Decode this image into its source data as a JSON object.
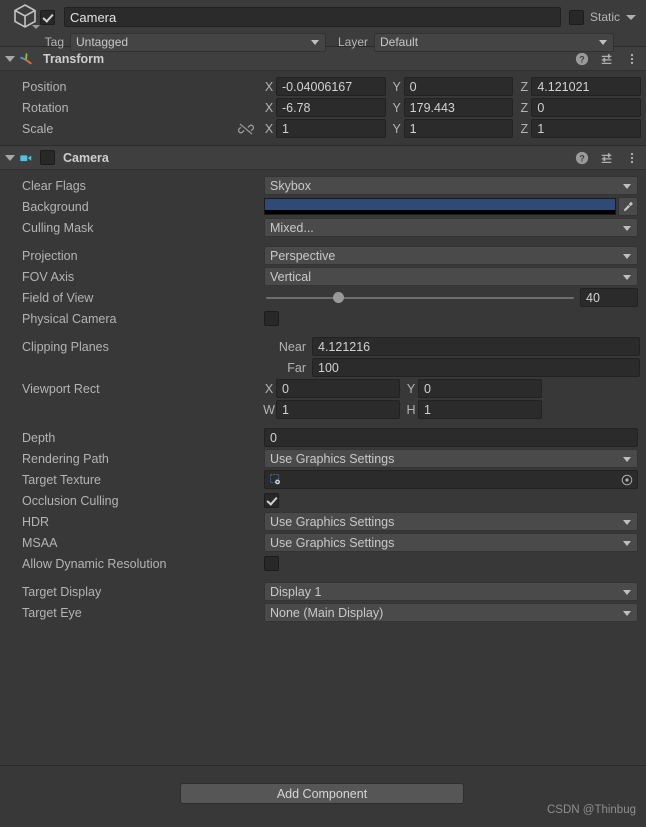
{
  "gameobject": {
    "icon": "cube-icon",
    "enabled_checkbox": true,
    "name_value": "Camera",
    "static_label": "Static",
    "static_checked": false,
    "tag_label": "Tag",
    "tag_value": "Untagged",
    "layer_label": "Layer",
    "layer_value": "Default"
  },
  "transform": {
    "title": "Transform",
    "icon": "transform-gizmo-icon",
    "expanded": true,
    "help_icon": "help-icon",
    "preset_icon": "preset-sliders-icon",
    "menu_icon": "three-dot-menu-icon",
    "rows": [
      {
        "label": "Position",
        "x": "-0.04006167",
        "y": "0",
        "z": "4.121021"
      },
      {
        "label": "Rotation",
        "x": "-6.78",
        "y": "179.443",
        "z": "0"
      },
      {
        "label": "Scale",
        "x": "1",
        "y": "1",
        "z": "1",
        "link_icon": "broken-link-icon"
      }
    ],
    "axis_labels": {
      "x": "X",
      "y": "Y",
      "z": "Z"
    }
  },
  "camera": {
    "title": "Camera",
    "icon": "camera-icon",
    "expanded": true,
    "enabled_checkbox": false,
    "help_icon": "help-icon",
    "preset_icon": "preset-sliders-icon",
    "menu_icon": "three-dot-menu-icon",
    "clear_flags": {
      "label": "Clear Flags",
      "value": "Skybox"
    },
    "background": {
      "label": "Background",
      "color": "#2F4A75",
      "alpha_color": "#000000",
      "picker_icon": "eyedropper-icon"
    },
    "culling_mask": {
      "label": "Culling Mask",
      "value": "Mixed..."
    },
    "projection": {
      "label": "Projection",
      "value": "Perspective"
    },
    "fov_axis": {
      "label": "FOV Axis",
      "value": "Vertical"
    },
    "field_of_view": {
      "label": "Field of View",
      "value": "40",
      "slider_percent": 22
    },
    "physical_camera": {
      "label": "Physical Camera",
      "checked": false
    },
    "clipping_planes": {
      "label": "Clipping Planes",
      "near_label": "Near",
      "near_value": "4.121216",
      "far_label": "Far",
      "far_value": "100"
    },
    "viewport_rect": {
      "label": "Viewport Rect",
      "x_label": "X",
      "x_value": "0",
      "y_label": "Y",
      "y_value": "0",
      "w_label": "W",
      "w_value": "1",
      "h_label": "H",
      "h_value": "1"
    },
    "depth": {
      "label": "Depth",
      "value": "0"
    },
    "rendering_path": {
      "label": "Rendering Path",
      "value": "Use Graphics Settings"
    },
    "target_texture": {
      "label": "Target Texture",
      "value": "",
      "icon": "render-texture-icon",
      "picker_icon": "object-picker-icon"
    },
    "occlusion_culling": {
      "label": "Occlusion Culling",
      "checked": true
    },
    "hdr": {
      "label": "HDR",
      "value": "Use Graphics Settings"
    },
    "msaa": {
      "label": "MSAA",
      "value": "Use Graphics Settings"
    },
    "allow_dynamic_resolution": {
      "label": "Allow Dynamic Resolution",
      "checked": false
    },
    "target_display": {
      "label": "Target Display",
      "value": "Display 1"
    },
    "target_eye": {
      "label": "Target Eye",
      "value": "None (Main Display)"
    }
  },
  "footer": {
    "add_component_label": "Add Component",
    "watermark": "CSDN @Thinbug"
  }
}
